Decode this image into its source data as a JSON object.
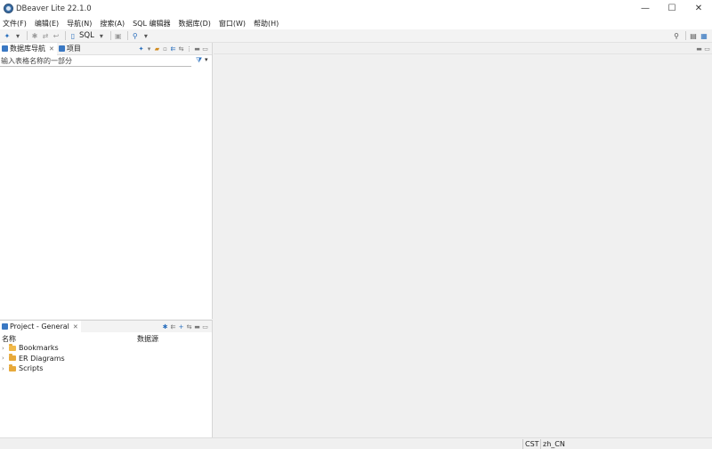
{
  "window": {
    "title": "DBeaver Lite 22.1.0",
    "controls": {
      "minimize": "—",
      "maximize": "☐",
      "close": "✕"
    }
  },
  "menubar": {
    "items": [
      "文件(F)",
      "编辑(E)",
      "导航(N)",
      "搜索(A)",
      "SQL 编辑器",
      "数据库(D)",
      "窗口(W)",
      "帮助(H)"
    ]
  },
  "toolbar": {
    "sql_label": "SQL",
    "icons": [
      "connect-icon",
      "dropdown-icon",
      "disconnect-icon",
      "commit-icon",
      "rollback-icon",
      "sql-editor-icon",
      "lock-icon",
      "search-icon"
    ]
  },
  "navigator": {
    "tabs": [
      {
        "label": "数据库导航",
        "active": true,
        "closable": true
      },
      {
        "label": "项目",
        "active": false,
        "closable": false
      }
    ],
    "filter_placeholder": "输入表格名称的一部分"
  },
  "project": {
    "tab_label": "Project - General",
    "columns": [
      "名称",
      "数据源"
    ],
    "items": [
      {
        "label": "Bookmarks",
        "icon": "bookmarks-folder-icon"
      },
      {
        "label": "ER Diagrams",
        "icon": "folder-icon"
      },
      {
        "label": "Scripts",
        "icon": "scripts-folder-icon"
      }
    ]
  },
  "statusbar": {
    "timezone": "CST",
    "locale": "zh_CN"
  }
}
